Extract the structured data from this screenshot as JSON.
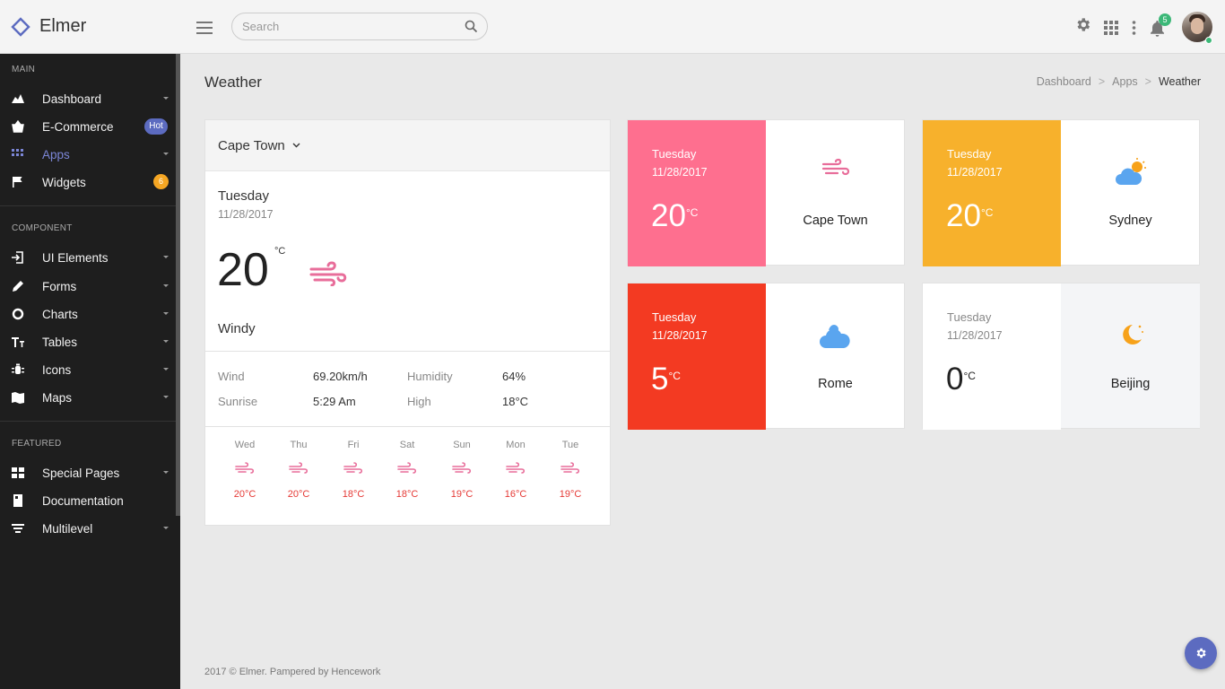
{
  "app": {
    "title": "Elmer"
  },
  "search": {
    "placeholder": "Search"
  },
  "header": {
    "notification_count": "5"
  },
  "colors": {
    "accent": "#5c6bc0",
    "pink": "#fe6f8f",
    "orange": "#f7b12c",
    "red": "#f33a22",
    "wind": "#e86d9a"
  },
  "sidebar": {
    "sections": [
      "MAIN",
      "COMPONENT",
      "FEATURED"
    ],
    "items": [
      {
        "label": "Dashboard",
        "icon": "chart-area-icon"
      },
      {
        "label": "E-Commerce",
        "icon": "basket-icon",
        "badge": "Hot"
      },
      {
        "label": "Apps",
        "icon": "apps-grid-icon",
        "active": true
      },
      {
        "label": "Widgets",
        "icon": "flag-icon",
        "badge": "6"
      },
      {
        "label": "UI Elements",
        "icon": "login-icon"
      },
      {
        "label": "Forms",
        "icon": "pencil-icon"
      },
      {
        "label": "Charts",
        "icon": "donut-chart-icon"
      },
      {
        "label": "Tables",
        "icon": "text-height-icon"
      },
      {
        "label": "Icons",
        "icon": "bug-icon"
      },
      {
        "label": "Maps",
        "icon": "map-icon"
      },
      {
        "label": "Special Pages",
        "icon": "pages-icon"
      },
      {
        "label": "Documentation",
        "icon": "book-icon"
      },
      {
        "label": "Multilevel",
        "icon": "filter-list-icon"
      }
    ]
  },
  "page": {
    "title": "Weather",
    "breadcrumbs": [
      "Dashboard",
      "Apps",
      "Weather"
    ]
  },
  "main_card": {
    "city": "Cape Town",
    "day": "Tuesday",
    "date": "11/28/2017",
    "temp": "20",
    "unit": "°C",
    "condition": "Windy",
    "details": {
      "wind_label": "Wind",
      "wind_value": "69.20km/h",
      "humidity_label": "Humidity",
      "humidity_value": "64%",
      "sunrise_label": "Sunrise",
      "sunrise_value": "5:29 Am",
      "high_label": "High",
      "high_value": "18°C"
    },
    "forecast": [
      {
        "day": "Wed",
        "temp": "20°C"
      },
      {
        "day": "Thu",
        "temp": "20°C"
      },
      {
        "day": "Fri",
        "temp": "18°C"
      },
      {
        "day": "Sat",
        "temp": "18°C"
      },
      {
        "day": "Sun",
        "temp": "19°C"
      },
      {
        "day": "Mon",
        "temp": "16°C"
      },
      {
        "day": "Tue",
        "temp": "19°C"
      }
    ]
  },
  "city_cards": [
    {
      "day": "Tuesday",
      "date": "11/28/2017",
      "temp": "20",
      "unit": "°C",
      "city": "Cape Town",
      "icon": "wind-icon",
      "color": "#fe6f8f"
    },
    {
      "day": "Tuesday",
      "date": "11/28/2017",
      "temp": "20",
      "unit": "°C",
      "city": "Sydney",
      "icon": "cloud-sun-icon",
      "color": "#f7b12c"
    },
    {
      "day": "Tuesday",
      "date": "11/28/2017",
      "temp": "5",
      "unit": "°C",
      "city": "Rome",
      "icon": "cloud-icon",
      "color": "#f33a22"
    },
    {
      "day": "Tuesday",
      "date": "11/28/2017",
      "temp": "0",
      "unit": "°C",
      "city": "Beijing",
      "icon": "moon-icon",
      "color": "#ffffff"
    }
  ],
  "footer": {
    "text": "2017 © Elmer. Pampered by Hencework"
  }
}
